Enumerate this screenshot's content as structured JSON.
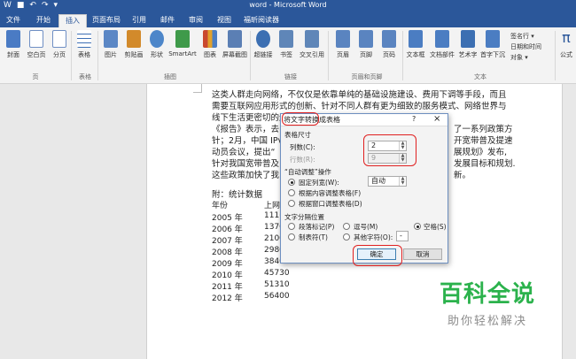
{
  "window": {
    "title": "word - Microsoft Word",
    "qat_icons": [
      "word-icon",
      "save-icon",
      "undo-icon",
      "redo-icon",
      "customize-icon"
    ]
  },
  "tabs": [
    {
      "label": "文件"
    },
    {
      "label": "开始"
    },
    {
      "label": "插入"
    },
    {
      "label": "页面布局"
    },
    {
      "label": "引用"
    },
    {
      "label": "邮件"
    },
    {
      "label": "审阅"
    },
    {
      "label": "视图"
    },
    {
      "label": "福昕阅读器"
    }
  ],
  "active_tab": "插入",
  "ribbon": {
    "buttons": [
      {
        "label": "封面",
        "color": "#4a7bc4"
      },
      {
        "label": "空白页",
        "color": "#6f8fc4"
      },
      {
        "label": "分页",
        "color": "#6f8fc4"
      },
      {
        "label": "表格",
        "color": "#3d6fb5"
      },
      {
        "label": "图片",
        "color": "#5b87c5"
      },
      {
        "label": "剪贴画",
        "color": "#d28a2b"
      },
      {
        "label": "形状",
        "color": "#4d86c9"
      },
      {
        "label": "SmartArt",
        "color": "#3f9a4a"
      },
      {
        "label": "图表",
        "color": "#c9492f"
      },
      {
        "label": "屏幕截图",
        "color": "#5b7fb4"
      },
      {
        "label": "超链接",
        "color": "#3c6fb2"
      },
      {
        "label": "书签",
        "color": "#5f86b8"
      },
      {
        "label": "交叉引用",
        "color": "#5f86b8"
      },
      {
        "label": "页眉",
        "color": "#5a84c0"
      },
      {
        "label": "页脚",
        "color": "#5a84c0"
      },
      {
        "label": "页码",
        "color": "#5a84c0"
      },
      {
        "label": "文本框",
        "color": "#4b7dc2"
      },
      {
        "label": "文档部件",
        "color": "#4b7dc2"
      },
      {
        "label": "艺术字",
        "color": "#3c6fb2"
      },
      {
        "label": "首字下沉",
        "color": "#4b7dc2"
      },
      {
        "label": "公式",
        "color": "#2b579a"
      }
    ],
    "groups": [
      "页",
      "表格",
      "插图",
      "链接",
      "页眉和页脚",
      "文本"
    ],
    "small_items": [
      "签名行 ▾",
      "日期和时间",
      "对象 ▾"
    ]
  },
  "document": {
    "paragraphs": [
      "这类人群走向网络，不仅仅是依靠单纯的基础设施建设、费用下调等手段，而且",
      "需要互联网应用形式的创新、针对不同人群有更为细致的服务模式、网络世界与",
      "线下生活更密切的连接",
      "《报告》表示，去",
      "针；2月，中国 IPv",
      "动员会议，提出“",
      "针对我国宽带普及",
      "这些政策加快了我"
    ],
    "paragraphs_right": [
      "了一系列政策方",
      "开宽带普及提速",
      "展规划》发布,",
      "发展目标和规划.",
      "新。"
    ],
    "attachment_title": "附：统计数据",
    "table_header": [
      "年份",
      "上网"
    ],
    "rows": [
      {
        "year": "2005 年",
        "value": "111("
      },
      {
        "year": "2006 年",
        "value": "1370"
      },
      {
        "year": "2007 年",
        "value": "2100"
      },
      {
        "year": "2008 年",
        "value": "2980"
      },
      {
        "year": "2009 年",
        "value": "3840"
      },
      {
        "year": "2010 年",
        "value": "45730"
      },
      {
        "year": "2011 年",
        "value": "51310"
      },
      {
        "year": "2012 年",
        "value": "56400"
      }
    ]
  },
  "dialog": {
    "title": "将文字转换成表格",
    "help": "?",
    "close": "×",
    "table_size": "表格尺寸",
    "columns_label": "列数(C):",
    "columns_value": "2",
    "rows_label": "行数(R):",
    "rows_value": "9",
    "autofit_title": "“自动调整”操作",
    "fixed_width": "固定列宽(W):",
    "fixed_value": "自动",
    "fit_content": "根据内容调整表格(F)",
    "fit_window": "根据窗口调整表格(D)",
    "separator_title": "文字分隔位置",
    "sep_paragraph": "段落标记(P)",
    "sep_comma": "逗号(M)",
    "sep_space": "空格(S)",
    "sep_tab": "制表符(T)",
    "sep_other": "其他字符(O):",
    "sep_other_value": "-",
    "ok": "确定",
    "cancel": "取消"
  },
  "watermark": {
    "big": "百科全说",
    "small": "助你轻松解决"
  }
}
